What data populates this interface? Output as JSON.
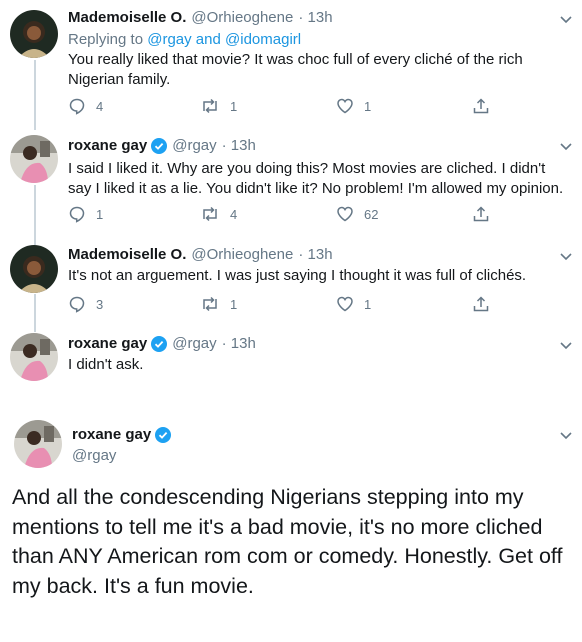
{
  "tweets": [
    {
      "name": "Mademoiselle O.",
      "handle": "@Orhieoghene",
      "time": "· 13h",
      "replying_prefix": "Replying to ",
      "replying_user1": "@rgay",
      "replying_and": " and ",
      "replying_user2": "@idomagirl",
      "text": "You really liked that movie? It was choc full of every cliché of the rich Nigerian family.",
      "replies": "4",
      "retweets": "1",
      "likes": "1"
    },
    {
      "name": "roxane gay",
      "handle": "@rgay",
      "time": "· 13h",
      "text": "I said I liked it. Why are you doing this? Most movies are cliched. I didn't say I liked it as a lie. You didn't like it? No problem! I'm allowed my opinion.",
      "replies": "1",
      "retweets": "4",
      "likes": "62"
    },
    {
      "name": "Mademoiselle O.",
      "handle": "@Orhieoghene",
      "time": "· 13h",
      "text": "It's not an arguement. I was just saying I thought it was full of clichés.",
      "replies": "3",
      "retweets": "1",
      "likes": "1"
    },
    {
      "name": "roxane gay",
      "handle": "@rgay",
      "time": "· 13h",
      "text": "I didn't ask."
    }
  ],
  "main_tweet": {
    "name": "roxane gay",
    "handle": "@rgay",
    "text": "And all the condescending Nigerians stepping into my mentions to tell me it's a bad movie, it's no more cliched than ANY American rom com or comedy. Honestly. Get off my back. It's a fun movie."
  },
  "colors": {
    "accent": "#1da1f2",
    "link": "#1b95e0",
    "secondary_text": "#657786",
    "thread_line": "#ccd6dd"
  }
}
